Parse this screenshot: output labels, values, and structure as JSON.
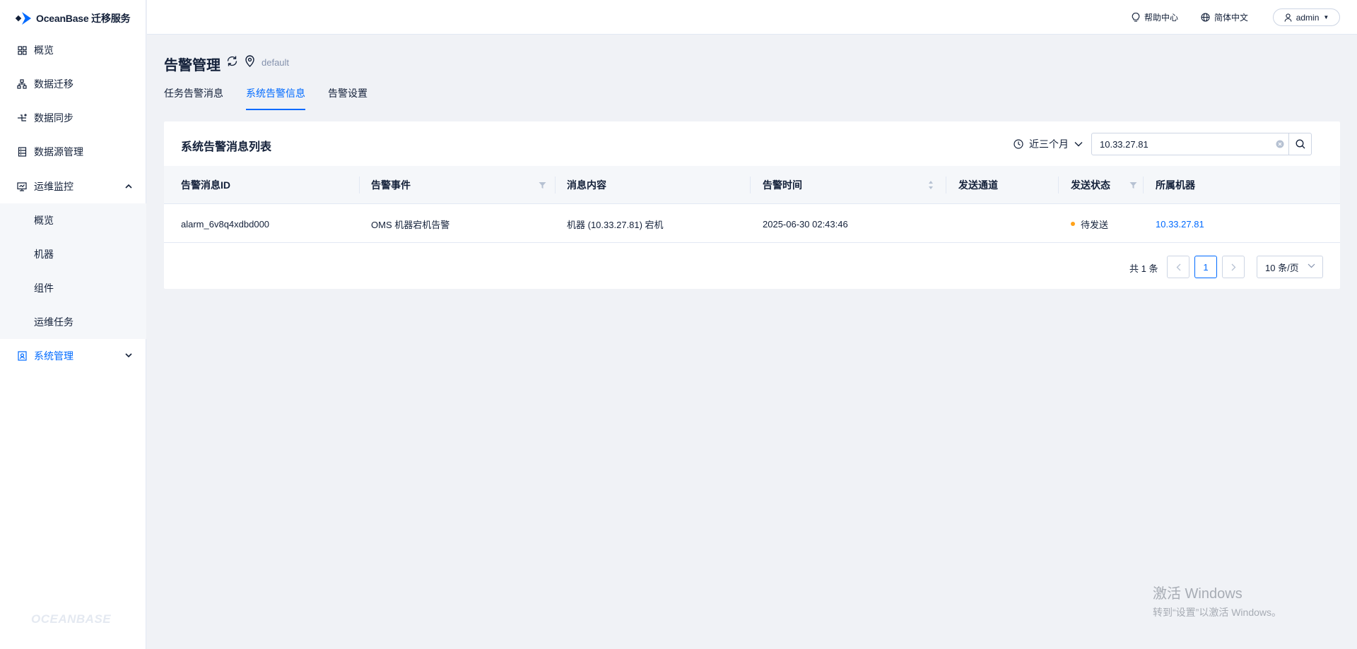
{
  "app": {
    "logo_text": "OceanBase 迁移服务",
    "side_watermark": "OCEANBASE",
    "accent": "#006aff"
  },
  "sidebar": {
    "items": [
      {
        "label": "概览",
        "icon": "grid-icon"
      },
      {
        "label": "数据迁移",
        "icon": "hierarchy-icon"
      },
      {
        "label": "数据同步",
        "icon": "sync-branch-icon"
      },
      {
        "label": "数据源管理",
        "icon": "database-icon"
      },
      {
        "label": "运维监控",
        "icon": "monitor-icon"
      },
      {
        "label": "系统管理",
        "icon": "system-icon"
      }
    ],
    "subitems": [
      {
        "label": "概览"
      },
      {
        "label": "机器"
      },
      {
        "label": "组件"
      },
      {
        "label": "运维任务"
      }
    ]
  },
  "topbar": {
    "help": "帮助中心",
    "lang": "简体中文",
    "user": "admin"
  },
  "page": {
    "title": "告警管理",
    "env": "default",
    "tabs": [
      {
        "label": "任务告警消息"
      },
      {
        "label": "系统告警信息"
      },
      {
        "label": "告警设置"
      }
    ]
  },
  "card": {
    "title": "系统告警消息列表",
    "time_filter": "近三个月",
    "search_value": "10.33.27.81",
    "columns": [
      "告警消息ID",
      "告警事件",
      "消息内容",
      "告警时间",
      "发送通道",
      "发送状态",
      "所属机器"
    ],
    "rows": [
      {
        "id": "alarm_6v8q4xdbd000",
        "event": "OMS 机器宕机告警",
        "content": "机器 (10.33.27.81) 宕机",
        "time": "2025-06-30 02:43:46",
        "channel": "",
        "status": "待发送",
        "status_color": "#ffa21a",
        "machine": "10.33.27.81"
      }
    ],
    "pagination": {
      "total": "共 1 条",
      "current": "1",
      "page_size": "10 条/页"
    }
  },
  "os_watermark": {
    "line1": "激活 Windows",
    "line2": "转到“设置”以激活 Windows。"
  }
}
